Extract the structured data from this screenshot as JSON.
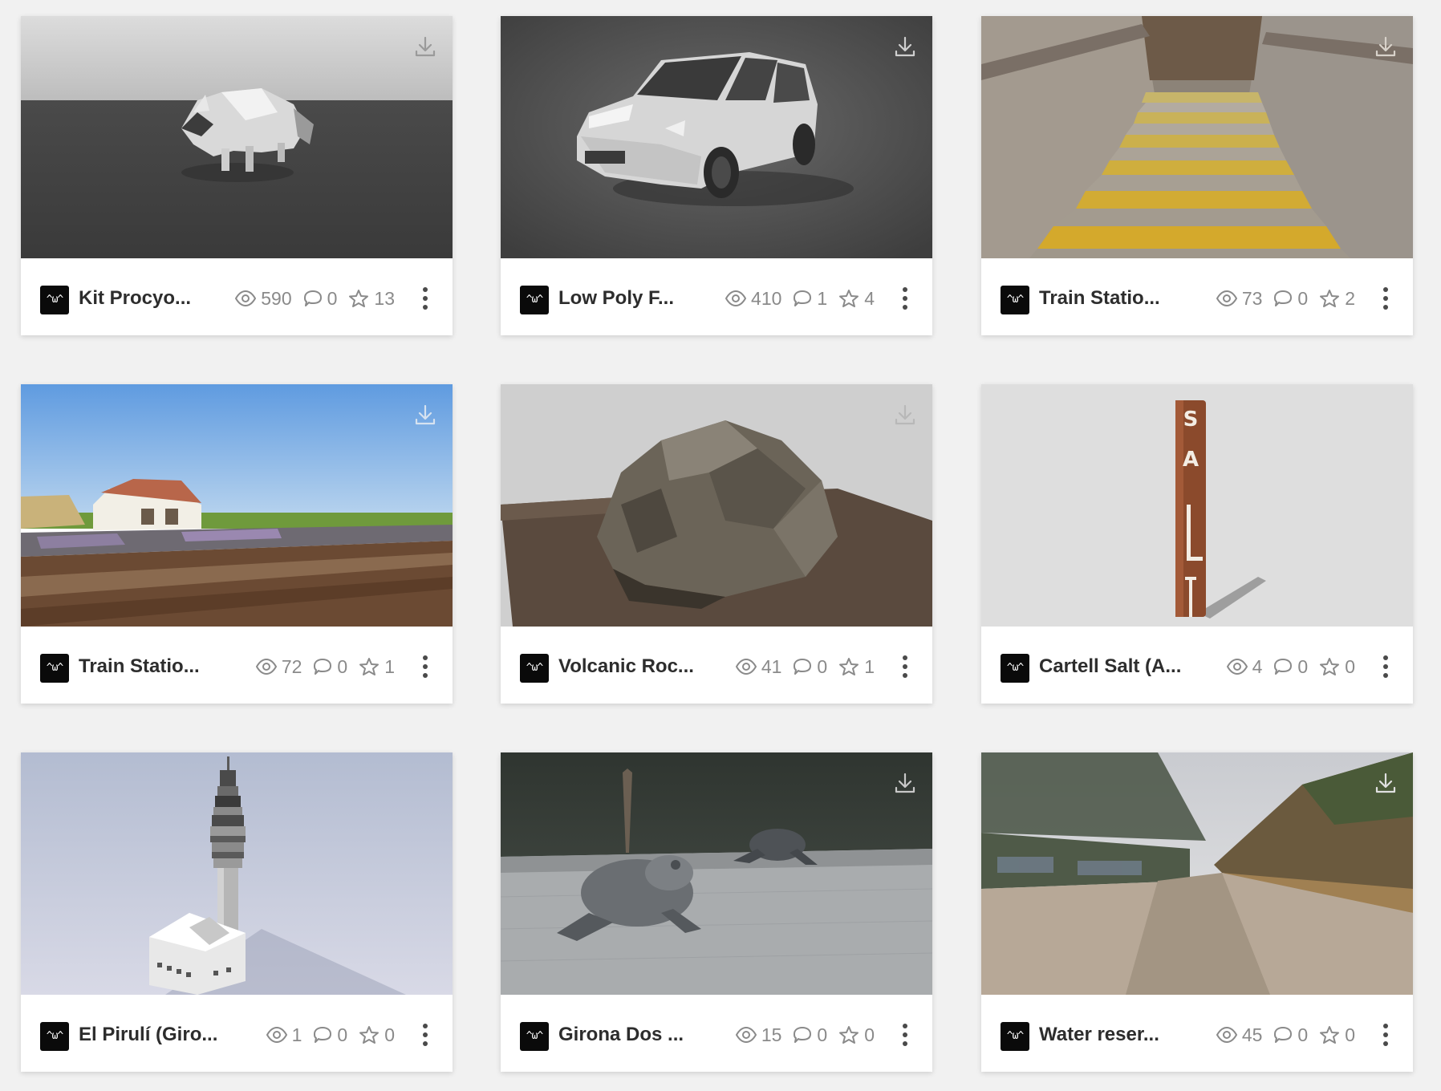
{
  "colors": {
    "page_background": "#f1f1f1",
    "card_background": "#ffffff",
    "title_text": "#2d2d2d",
    "stat_text": "#8a8a8a",
    "avatar_background": "#0a0a0a"
  },
  "models": [
    {
      "title": "Kit Procyo...",
      "avatar": "^ω^",
      "views": "590",
      "comments": "0",
      "likes": "13",
      "thumbnail": "low-poly-raccoon"
    },
    {
      "title": "Low Poly F...",
      "avatar": "^ω^",
      "views": "410",
      "comments": "1",
      "likes": "4",
      "thumbnail": "low-poly-car"
    },
    {
      "title": "Train Statio...",
      "avatar": "^ω^",
      "views": "73",
      "comments": "0",
      "likes": "2",
      "thumbnail": "station-stairs"
    },
    {
      "title": "Train Statio...",
      "avatar": "^ω^",
      "views": "72",
      "comments": "0",
      "likes": "1",
      "thumbnail": "train-station-tracks"
    },
    {
      "title": "Volcanic Roc...",
      "avatar": "^ω^",
      "views": "41",
      "comments": "0",
      "likes": "1",
      "thumbnail": "volcanic-rock"
    },
    {
      "title": "Cartell Salt (A...",
      "avatar": "^ω^",
      "views": "4",
      "comments": "0",
      "likes": "0",
      "thumbnail": "salt-sign-post"
    },
    {
      "title": "El Pirulí (Giro...",
      "avatar": "^ω^",
      "views": "1",
      "comments": "0",
      "likes": "0",
      "thumbnail": "telecom-tower"
    },
    {
      "title": "Girona Dos ...",
      "avatar": "^ω^",
      "views": "15",
      "comments": "0",
      "likes": "0",
      "thumbnail": "frog-sculptures"
    },
    {
      "title": "Water reser...",
      "avatar": "^ω^",
      "views": "45",
      "comments": "0",
      "likes": "0",
      "thumbnail": "water-reservoir-road"
    }
  ]
}
